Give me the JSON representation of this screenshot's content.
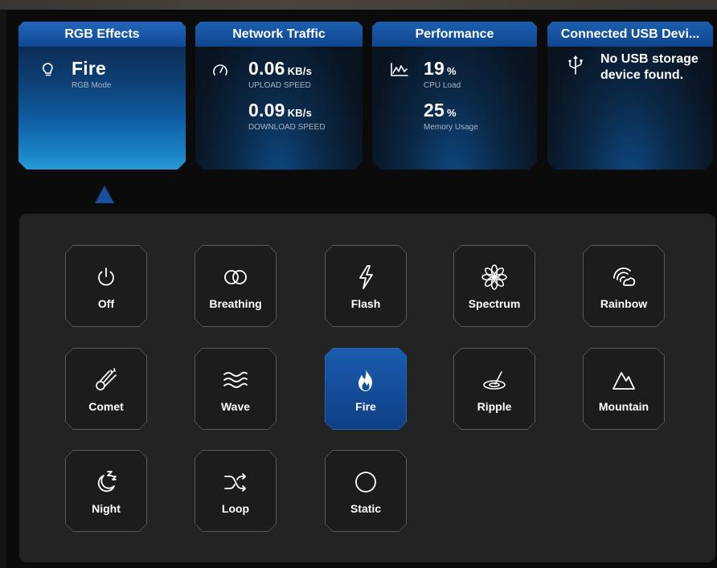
{
  "cards": {
    "rgb": {
      "title": "RGB Effects",
      "value": "Fire",
      "label": "RGB Mode"
    },
    "network": {
      "title": "Network Traffic",
      "upload_value": "0.06",
      "upload_unit": "KB/s",
      "upload_label": "UPLOAD SPEED",
      "download_value": "0.09",
      "download_unit": "KB/s",
      "download_label": "DOWNLOAD SPEED"
    },
    "performance": {
      "title": "Performance",
      "cpu_value": "19",
      "cpu_unit": "%",
      "cpu_label": "CPU Load",
      "mem_value": "25",
      "mem_unit": "%",
      "mem_label": "Memory Usage"
    },
    "usb": {
      "title": "Connected USB Devi...",
      "message": "No USB storage device found."
    }
  },
  "effects": [
    {
      "label": "Off",
      "icon": "power-icon"
    },
    {
      "label": "Breathing",
      "icon": "breathing-icon"
    },
    {
      "label": "Flash",
      "icon": "lightning-icon"
    },
    {
      "label": "Spectrum",
      "icon": "spectrum-icon"
    },
    {
      "label": "Rainbow",
      "icon": "rainbow-icon"
    },
    {
      "label": "Comet",
      "icon": "comet-icon"
    },
    {
      "label": "Wave",
      "icon": "wave-icon"
    },
    {
      "label": "Fire",
      "icon": "flame-icon",
      "selected": true
    },
    {
      "label": "Ripple",
      "icon": "ripple-icon"
    },
    {
      "label": "Mountain",
      "icon": "mountain-icon"
    },
    {
      "label": "Night",
      "icon": "moon-icon"
    },
    {
      "label": "Loop",
      "icon": "shuffle-icon"
    },
    {
      "label": "Static",
      "icon": "circle-icon"
    }
  ],
  "colors": {
    "accent": "#1a5cae",
    "card_header": "#1b5fb0",
    "panel": "#232323"
  }
}
